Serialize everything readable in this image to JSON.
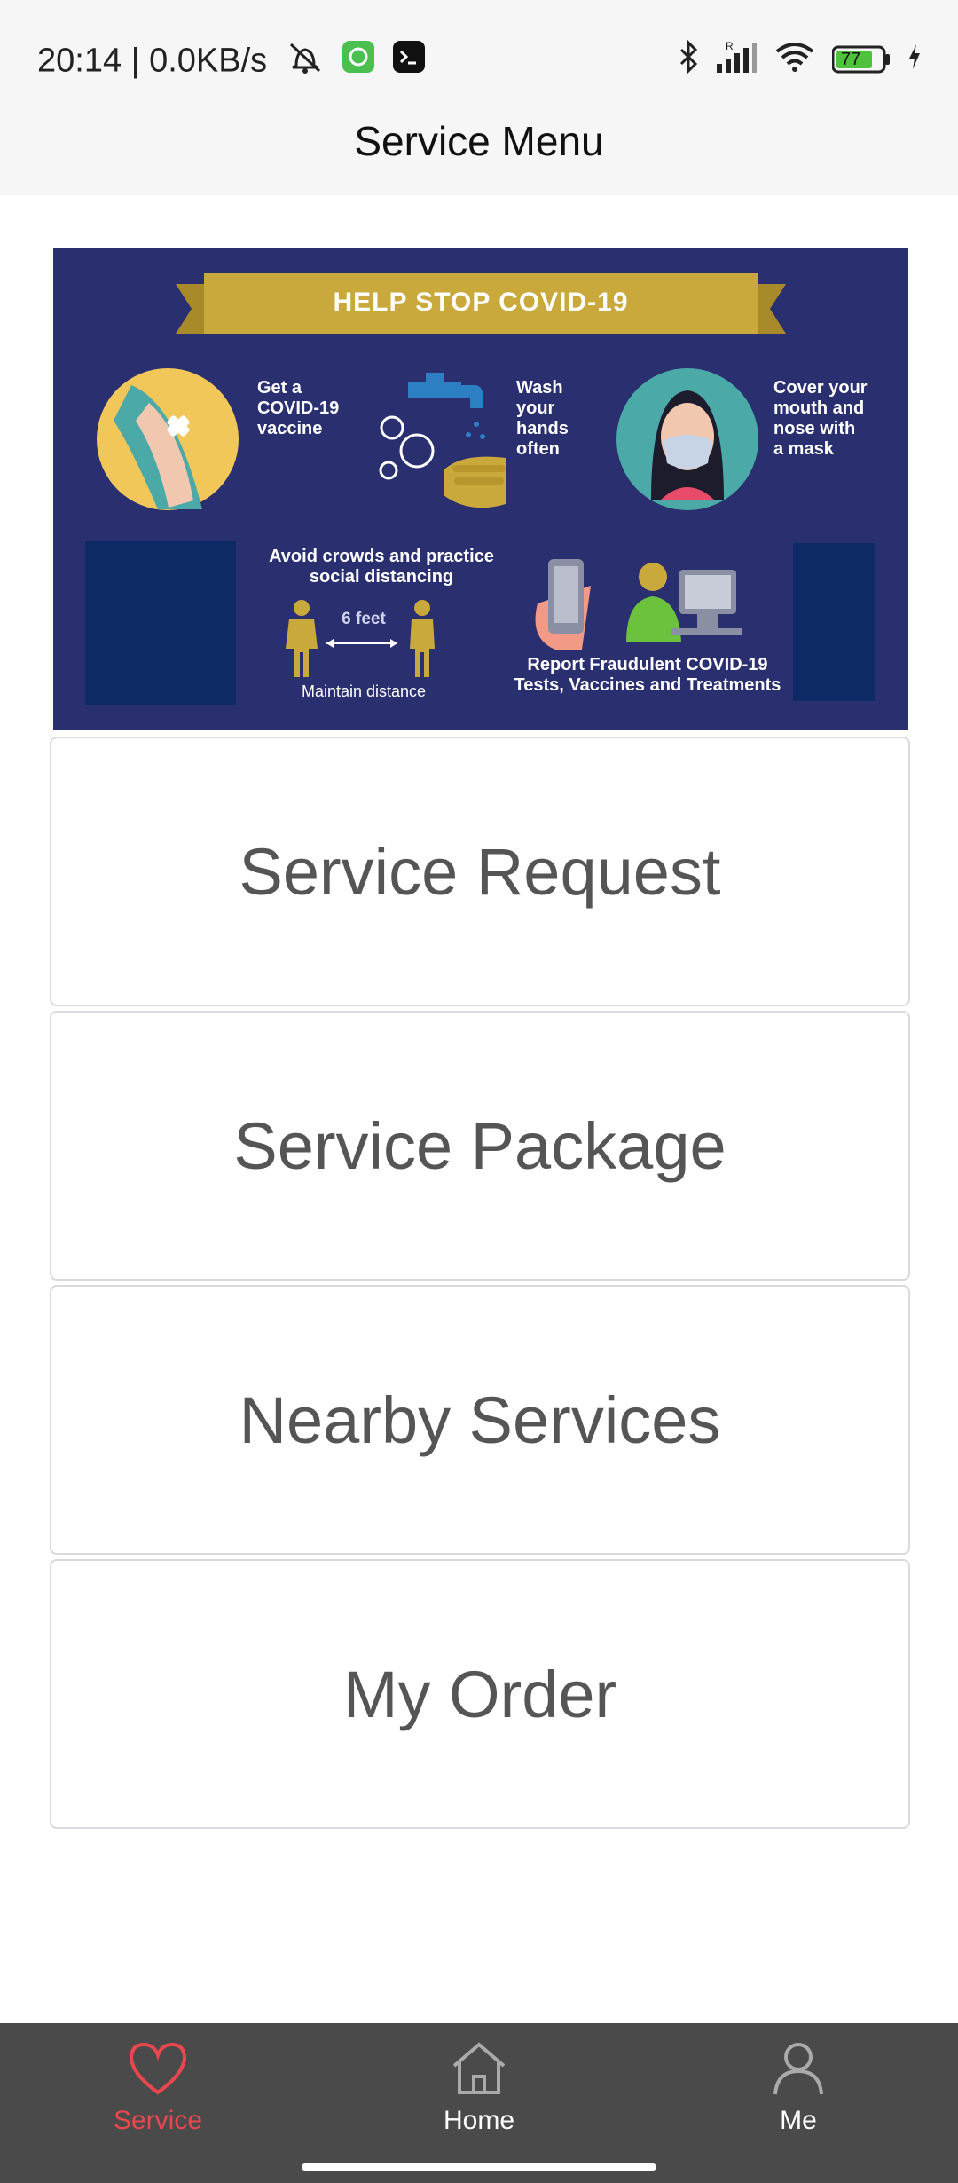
{
  "status_bar": {
    "time": "20:14",
    "separator": "|",
    "network_speed": "0.0KB/s",
    "battery_level": "77",
    "icons": [
      "mute-icon",
      "app-notification-icon",
      "terminal-icon",
      "bluetooth-icon",
      "signal-icon",
      "wifi-icon",
      "battery-icon",
      "charging-icon"
    ]
  },
  "header": {
    "title": "Service Menu"
  },
  "banner": {
    "heading": "HELP STOP COVID-19",
    "tips": {
      "vaccine": "Get a\nCOVID-19\nvaccine",
      "wash": "Wash\nyour\nhands\noften",
      "mask": "Cover your\nmouth and\nnose with\na mask",
      "distance": "Avoid crowds and practice\nsocial distancing",
      "distance_label": "6 feet",
      "maintain": "Maintain distance",
      "report": "Report Fraudulent COVID-19\nTests, Vaccines and Treatments"
    }
  },
  "menu": {
    "items": [
      {
        "label": "Service Request"
      },
      {
        "label": "Service Package"
      },
      {
        "label": "Nearby Services"
      },
      {
        "label": "My Order"
      }
    ]
  },
  "bottom_nav": {
    "items": [
      {
        "label": "Service",
        "icon": "heart-icon",
        "active": true
      },
      {
        "label": "Home",
        "icon": "home-icon",
        "active": false
      },
      {
        "label": "Me",
        "icon": "user-icon",
        "active": false
      }
    ],
    "active_color": "#e8474f",
    "inactive_color": "#ffffff",
    "background": "#4a4a4a"
  }
}
